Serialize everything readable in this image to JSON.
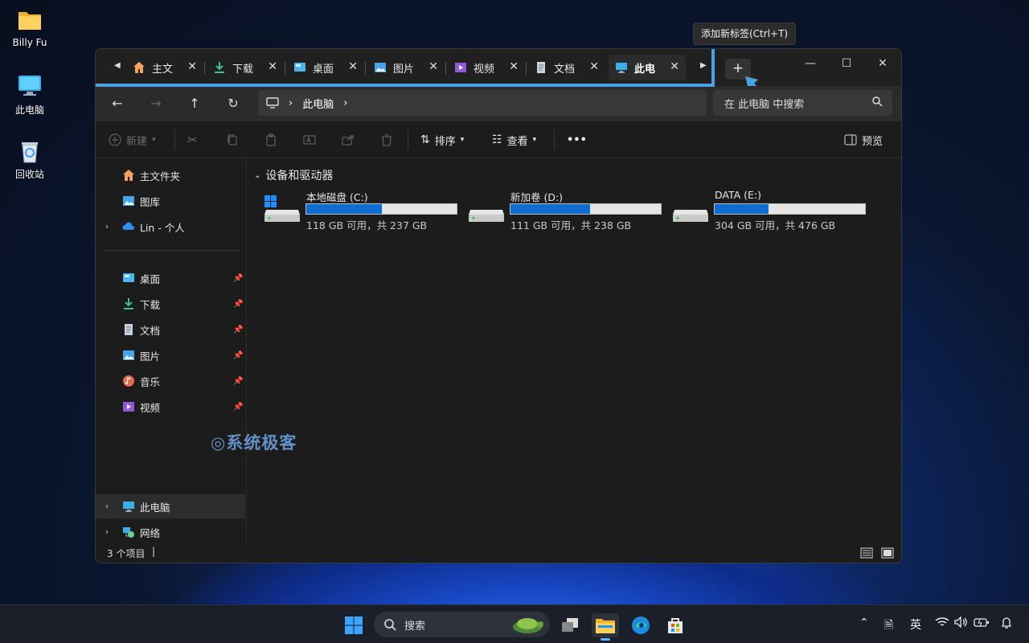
{
  "desktop": {
    "icons": [
      {
        "label": "Billy Fu",
        "icon": "folder-icon"
      },
      {
        "label": "此电脑",
        "icon": "computer-icon"
      },
      {
        "label": "回收站",
        "icon": "recycle-bin-icon"
      }
    ]
  },
  "tabs": [
    {
      "label": "主文",
      "icon": "home-icon"
    },
    {
      "label": "下载",
      "icon": "download-icon"
    },
    {
      "label": "桌面",
      "icon": "desktop-icon"
    },
    {
      "label": "图片",
      "icon": "pictures-icon"
    },
    {
      "label": "视频",
      "icon": "videos-icon"
    },
    {
      "label": "文档",
      "icon": "documents-icon"
    },
    {
      "label": "此电",
      "icon": "computer-icon",
      "active": true
    }
  ],
  "tab_close": "✕",
  "new_tab": {
    "label": "+",
    "tooltip": "添加新标签(Ctrl+T)"
  },
  "window_controls": {
    "minimize": "—",
    "maximize": "☐",
    "close": "✕"
  },
  "navigation": {
    "back": "←",
    "forward": "→",
    "up": "↑",
    "refresh": "↻",
    "address": {
      "location": "此电脑",
      "separator": "›"
    },
    "search": {
      "placeholder": "在 此电脑 中搜索"
    }
  },
  "toolbar": {
    "new_label": "新建",
    "sort_label": "排序",
    "view_label": "查看",
    "more_label": "•••",
    "preview_label": "预览"
  },
  "sidebar": {
    "top": [
      {
        "label": "主文件夹",
        "icon": "home-icon"
      },
      {
        "label": "图库",
        "icon": "gallery-icon"
      },
      {
        "label": "Lin - 个人",
        "icon": "onedrive-cloud-icon",
        "expandable": true
      }
    ],
    "quick_access": [
      {
        "label": "桌面",
        "icon": "desktop-icon",
        "pinned": true
      },
      {
        "label": "下载",
        "icon": "download-icon",
        "pinned": true
      },
      {
        "label": "文档",
        "icon": "documents-icon",
        "pinned": true
      },
      {
        "label": "图片",
        "icon": "pictures-icon",
        "pinned": true
      },
      {
        "label": "音乐",
        "icon": "music-icon",
        "pinned": true
      },
      {
        "label": "视频",
        "icon": "videos-icon",
        "pinned": true
      }
    ],
    "bottom": [
      {
        "label": "此电脑",
        "icon": "computer-icon",
        "selected": true
      },
      {
        "label": "网络",
        "icon": "network-icon"
      }
    ]
  },
  "content": {
    "group_title": "设备和驱动器",
    "drives": [
      {
        "name": "本地磁盘 (C:)",
        "free": "118 GB 可用，共 237 GB",
        "used_fraction": 0.5,
        "system": true
      },
      {
        "name": "新加卷 (D:)",
        "free": "111 GB 可用，共 238 GB",
        "used_fraction": 0.53
      },
      {
        "name": "DATA (E:)",
        "free": "304 GB 可用，共 476 GB",
        "used_fraction": 0.36
      }
    ]
  },
  "status": {
    "item_count": "3 个项目"
  },
  "watermark": "系统极客",
  "taskbar": {
    "search_label": "搜索",
    "ime": "英"
  },
  "colors": {
    "accent": "#0f6cd1",
    "highlight_frame": "#4aa3e6"
  }
}
